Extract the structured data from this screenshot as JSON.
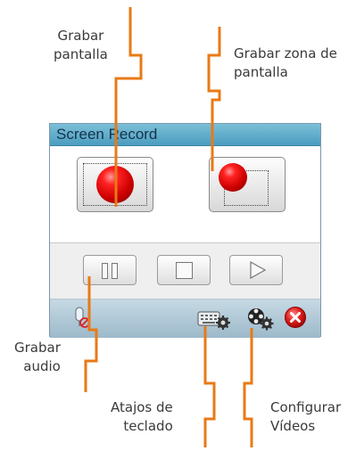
{
  "window": {
    "title": "Screen Record"
  },
  "callouts": {
    "grabar_pantalla": [
      "Grabar",
      "pantalla"
    ],
    "grabar_zona": [
      "Grabar zona de",
      "pantalla"
    ],
    "grabar_audio": [
      "Grabar",
      "audio"
    ],
    "atajos": [
      "Atajos de",
      "teclado"
    ],
    "configurar": [
      "Configurar",
      "Vídeos"
    ]
  },
  "icons": {
    "record_full": "record-full-screen-icon",
    "record_zone": "record-screen-zone-icon",
    "pause": "pause-icon",
    "stop": "stop-icon",
    "play": "play-icon",
    "mic": "microphone-muted-icon",
    "keyboard": "keyboard-gear-icon",
    "video_config": "film-reel-gear-icon",
    "close": "close-icon"
  },
  "colors": {
    "callout_line": "#e87a16",
    "title_bar": "#5aa8c8",
    "record_red": "#dd0000",
    "close_red": "#e02020"
  }
}
